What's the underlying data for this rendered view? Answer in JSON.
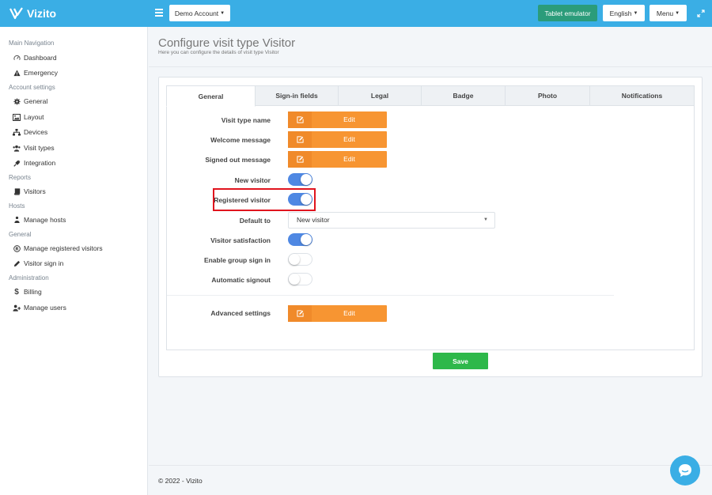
{
  "app": {
    "name": "Vizito"
  },
  "topbar": {
    "account_label": "Demo Account",
    "tablet_label": "Tablet emulator",
    "language_label": "English",
    "menu_label": "Menu"
  },
  "sidebar": {
    "sections": [
      {
        "header": "Main Navigation",
        "items": [
          {
            "label": "Dashboard",
            "icon": "dashboard-icon"
          },
          {
            "label": "Emergency",
            "icon": "warning-icon"
          }
        ]
      },
      {
        "header": "Account settings",
        "items": [
          {
            "label": "General",
            "icon": "gear-icon"
          },
          {
            "label": "Layout",
            "icon": "image-icon"
          },
          {
            "label": "Devices",
            "icon": "sitemap-icon"
          },
          {
            "label": "Visit types",
            "icon": "users-icon"
          },
          {
            "label": "Integration",
            "icon": "plug-icon"
          }
        ]
      },
      {
        "header": "Reports",
        "items": [
          {
            "label": "Visitors",
            "icon": "book-icon"
          }
        ]
      },
      {
        "header": "Hosts",
        "items": [
          {
            "label": "Manage hosts",
            "icon": "host-icon"
          }
        ]
      },
      {
        "header": "General",
        "items": [
          {
            "label": "Manage registered visitors",
            "icon": "registered-icon"
          },
          {
            "label": "Visitor sign in",
            "icon": "pencil-icon"
          }
        ]
      },
      {
        "header": "Administration",
        "items": [
          {
            "label": "Billing",
            "icon": "dollar-icon"
          },
          {
            "label": "Manage users",
            "icon": "add-user-icon"
          }
        ]
      }
    ]
  },
  "page": {
    "title": "Configure visit type Visitor",
    "subtitle": "Here you can configure the details of visit type Visitor"
  },
  "tabs": [
    "General",
    "Sign-in fields",
    "Legal",
    "Badge",
    "Photo",
    "Notifications"
  ],
  "active_tab": "General",
  "form": {
    "visit_type_name": {
      "label": "Visit type name",
      "button": "Edit"
    },
    "welcome_message": {
      "label": "Welcome message",
      "button": "Edit"
    },
    "signed_out_message": {
      "label": "Signed out message",
      "button": "Edit"
    },
    "new_visitor": {
      "label": "New visitor",
      "on": true
    },
    "registered_visitor": {
      "label": "Registered visitor",
      "on": true
    },
    "default_to": {
      "label": "Default to",
      "value": "New visitor"
    },
    "visitor_satisfaction": {
      "label": "Visitor satisfaction",
      "on": true
    },
    "enable_group_sign_in": {
      "label": "Enable group sign in",
      "on": false
    },
    "automatic_signout": {
      "label": "Automatic signout",
      "on": false
    },
    "advanced_settings": {
      "label": "Advanced settings",
      "button": "Edit"
    }
  },
  "save_label": "Save",
  "footer": "© 2022 - Vizito",
  "colors": {
    "brand": "#3aaee5",
    "edit_button": "#f79532",
    "toggle_on": "#4f88e3",
    "save_button": "#2eb84a",
    "tablet_button": "#2b9c7a",
    "highlight": "#e0141e"
  }
}
